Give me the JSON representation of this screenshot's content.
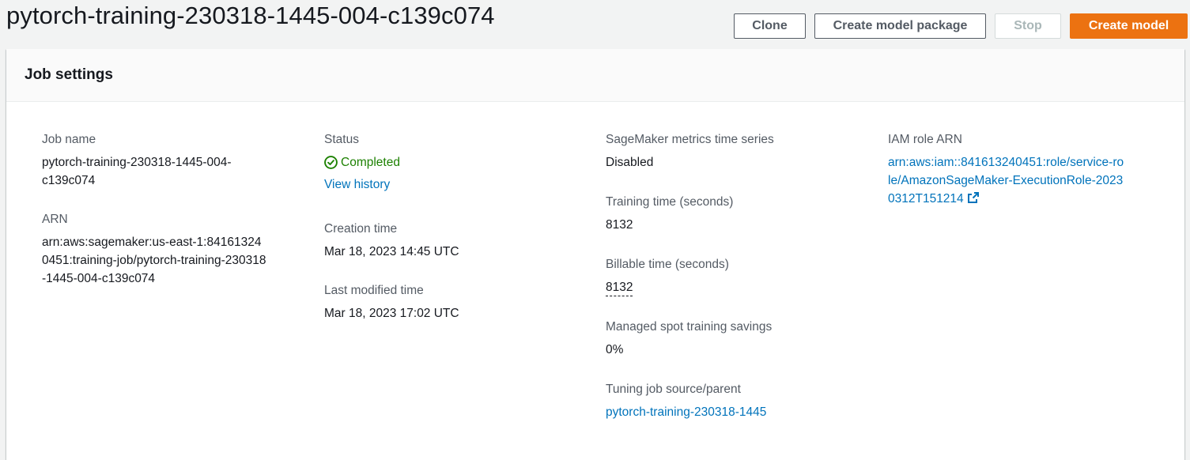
{
  "page": {
    "title": "pytorch-training-230318-1445-004-c139c074"
  },
  "actions": {
    "clone": "Clone",
    "create_model_package": "Create model package",
    "stop": "Stop",
    "create_model": "Create model"
  },
  "panel": {
    "title": "Job settings"
  },
  "fields": {
    "job_name": {
      "label": "Job name",
      "value": "pytorch-training-230318-1445-004-c139c074"
    },
    "arn": {
      "label": "ARN",
      "value": "arn:aws:sagemaker:us-east-1:841613240451:training-job/pytorch-training-230318-1445-004-c139c074"
    },
    "status": {
      "label": "Status",
      "value": "Completed",
      "link": "View history"
    },
    "creation_time": {
      "label": "Creation time",
      "value": "Mar 18, 2023 14:45 UTC"
    },
    "last_modified_time": {
      "label": "Last modified time",
      "value": "Mar 18, 2023 17:02 UTC"
    },
    "metrics_time_series": {
      "label": "SageMaker metrics time series",
      "value": "Disabled"
    },
    "training_time": {
      "label": "Training time (seconds)",
      "value": "8132"
    },
    "billable_time": {
      "label": "Billable time (seconds)",
      "value": "8132"
    },
    "spot_savings": {
      "label": "Managed spot training savings",
      "value": "0%"
    },
    "tuning_job": {
      "label": "Tuning job source/parent",
      "value": "pytorch-training-230318-1445"
    },
    "iam_role_arn": {
      "label": "IAM role ARN",
      "value": "arn:aws:iam::841613240451:role/service-role/AmazonSageMaker-ExecutionRole-20230312T151214"
    }
  },
  "colors": {
    "primary_button": "#ec7211",
    "link": "#0073bb",
    "success": "#1d8102"
  },
  "icons": {
    "status": "check-circle-icon",
    "iam_link": "external-link-icon"
  }
}
